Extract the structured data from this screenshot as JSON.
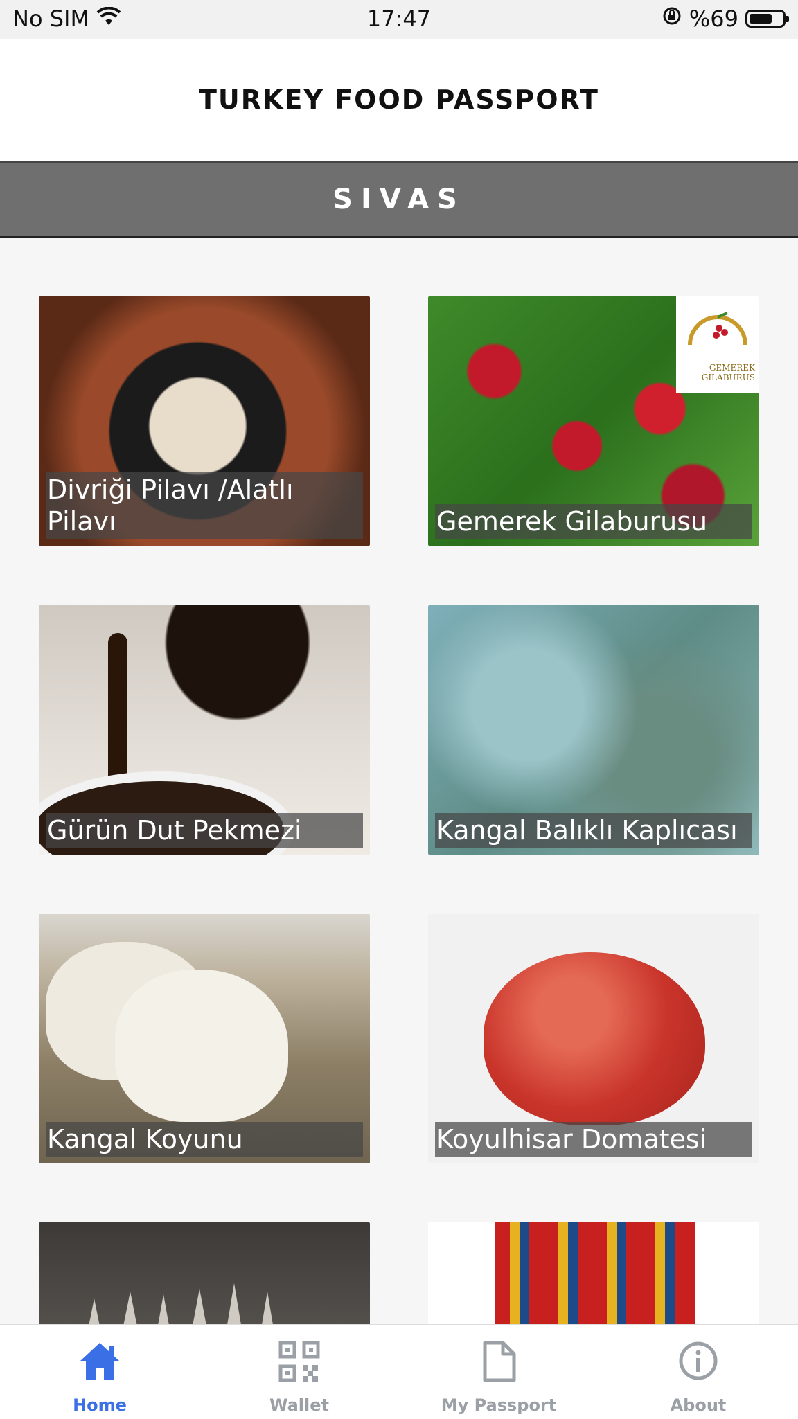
{
  "status_bar": {
    "carrier": "No SIM",
    "time": "17:47",
    "battery_text": "%69",
    "battery_level": 0.69
  },
  "header": {
    "title": "TURKEY FOOD PASSPORT"
  },
  "section": {
    "title": "SIVAS"
  },
  "items": [
    {
      "label": "Divriği Pilavı /Alatlı Pilavı"
    },
    {
      "label": "Gemerek Gilaburusu",
      "logo_text": "GEMEREK GİLABURUS"
    },
    {
      "label": "Gürün Dut Pekmezi"
    },
    {
      "label": "Kangal Balıklı Kaplıcası"
    },
    {
      "label": "Kangal Koyunu"
    },
    {
      "label": "Koyulhisar Domatesi"
    },
    {
      "label": ""
    },
    {
      "label": ""
    }
  ],
  "tab_bar": {
    "tabs": [
      {
        "label": "Home",
        "icon": "home-icon",
        "active": true
      },
      {
        "label": "Wallet",
        "icon": "qr-code-icon",
        "active": false
      },
      {
        "label": "My Passport",
        "icon": "document-icon",
        "active": false
      },
      {
        "label": "About",
        "icon": "info-icon",
        "active": false
      }
    ],
    "active_color": "#3b6fe5",
    "inactive_color": "#9aa0a6"
  }
}
